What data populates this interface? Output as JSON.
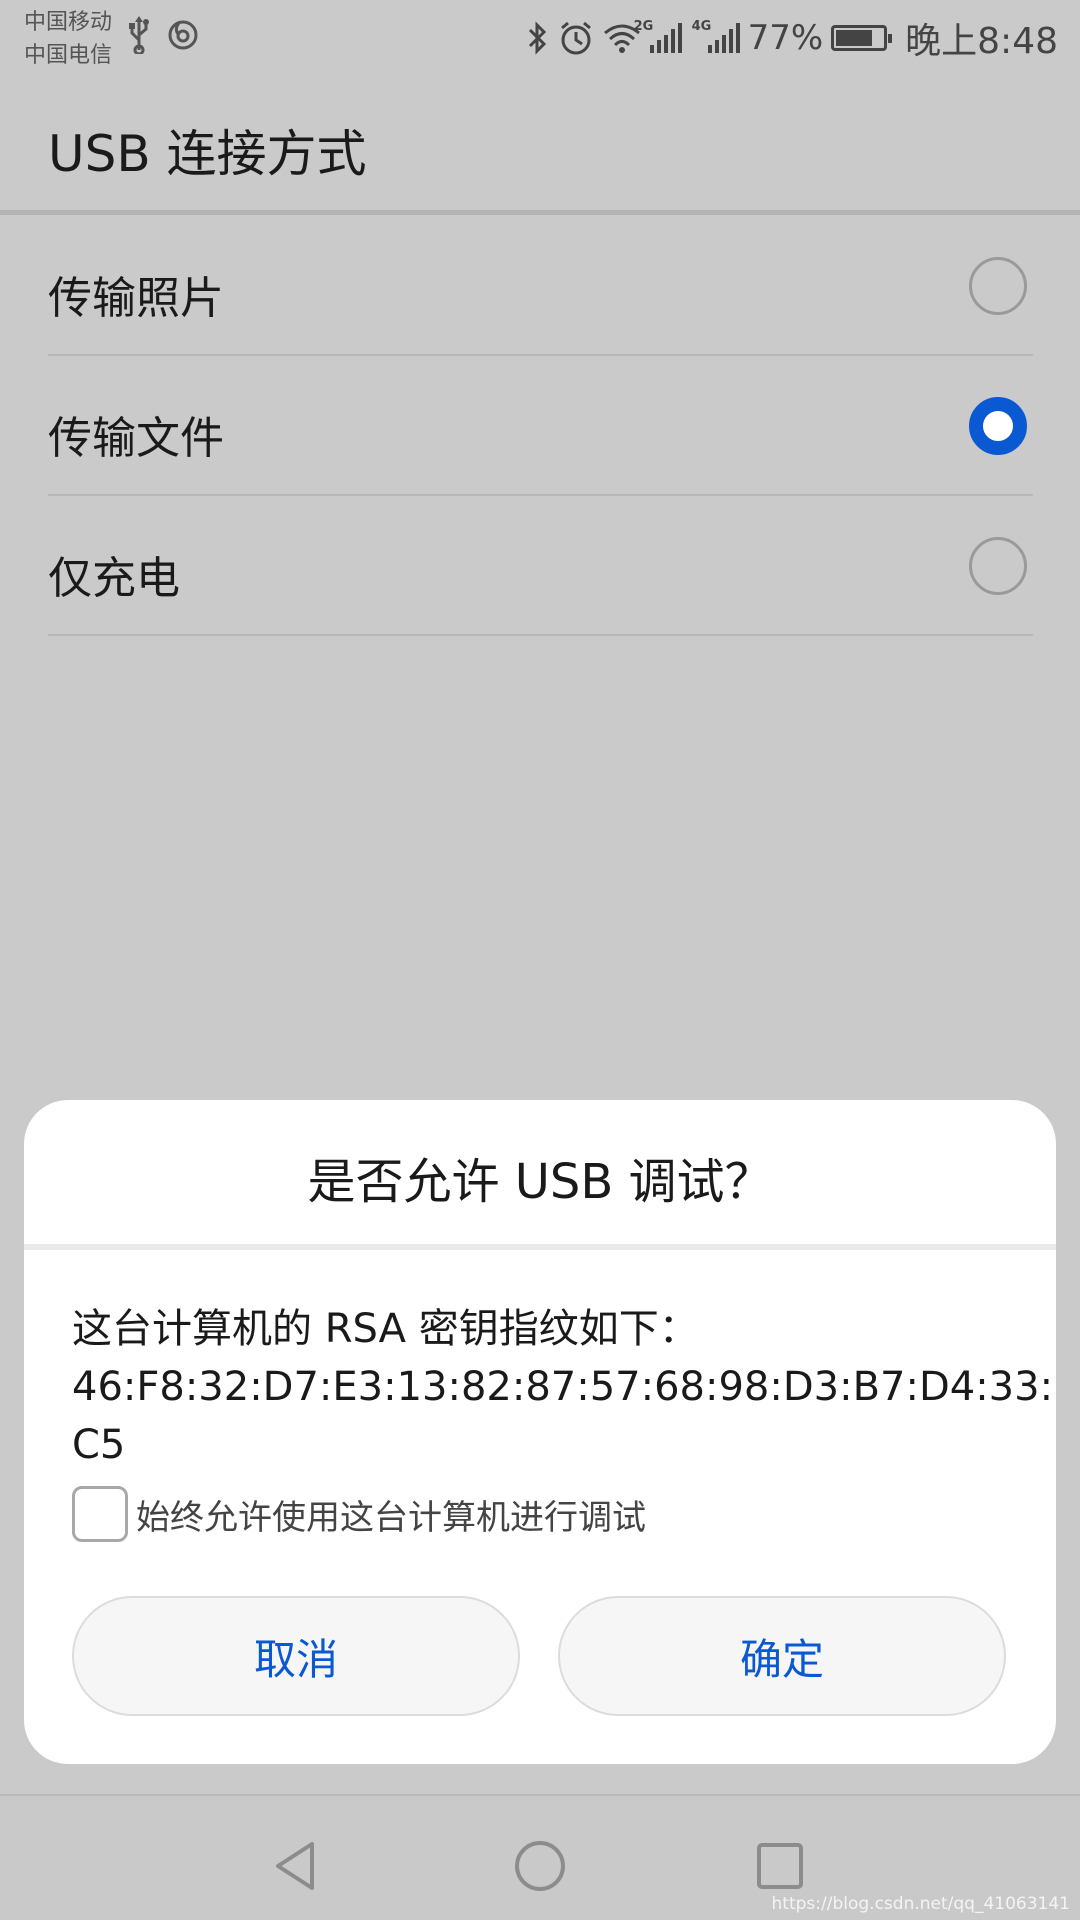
{
  "status_bar": {
    "carrier_1": "中国移动",
    "carrier_2": "中国电信",
    "signal_1_tag": "2G",
    "signal_2_tag": "4G",
    "battery_percent": "77%",
    "battery_level": 0.77,
    "time": "晚上8:48",
    "icons": [
      "usb-icon",
      "music-icon",
      "bluetooth-icon",
      "alarm-icon",
      "wifi-icon",
      "signal-icon",
      "signal-icon",
      "battery-charging-icon"
    ]
  },
  "header": {
    "title": "USB 连接方式"
  },
  "options": [
    {
      "label": "传输照片",
      "selected": false
    },
    {
      "label": "传输文件",
      "selected": true
    },
    {
      "label": "仅充电",
      "selected": false
    }
  ],
  "dialog": {
    "title": "是否允许 USB 调试？",
    "message_line1": "这台计算机的 RSA 密钥指纹如下：",
    "fingerprint_line1": "46:F8:32:D7:E3:13:82:87:57:68:98:D3:B7:D4:33:",
    "fingerprint_line2": "C5",
    "checkbox_label": "始终允许使用这台计算机进行调试",
    "checkbox_checked": false,
    "cancel_label": "取消",
    "ok_label": "确定"
  },
  "nav": {
    "icons": [
      "back-icon",
      "home-icon",
      "recents-icon"
    ]
  },
  "watermark": "https://blog.csdn.net/qq_41063141",
  "colors": {
    "accent": "#0a59d2",
    "scrim_background": "#cacaca",
    "dialog_background": "#ffffff"
  }
}
